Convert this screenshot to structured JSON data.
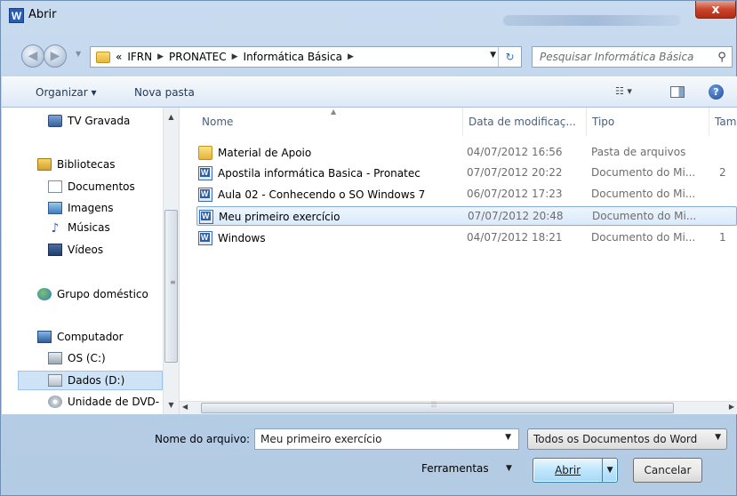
{
  "window": {
    "title": "Abrir",
    "app_icon": "W",
    "close_label": "x"
  },
  "address": {
    "prefix": "«",
    "crumbs": [
      "IFRN",
      "PRONATEC",
      "Informática Básica"
    ],
    "search_placeholder": "Pesquisar Informática Básica"
  },
  "toolbar": {
    "organizar": "Organizar ▾",
    "nova_pasta": "Nova pasta",
    "help": "?"
  },
  "nav": {
    "tv": "TV Gravada",
    "bibliotecas": "Bibliotecas",
    "documentos": "Documentos",
    "imagens": "Imagens",
    "musicas": "Músicas",
    "videos": "Vídeos",
    "grupo": "Grupo doméstico",
    "computador": "Computador",
    "os_c": "OS (C:)",
    "dados_d": "Dados (D:)",
    "dvd": "Unidade de DVD-"
  },
  "columns": {
    "nome": "Nome",
    "data": "Data de modificaç...",
    "tipo": "Tipo",
    "tamanho": "Tam"
  },
  "files": [
    {
      "name": "Material de Apoio",
      "date": "04/07/2012 16:56",
      "type": "Pasta de arquivos",
      "size": ""
    },
    {
      "name": "Apostila informática Basica - Pronatec",
      "date": "07/07/2012 20:22",
      "type": "Documento do Mi...",
      "size": "2"
    },
    {
      "name": "Aula 02 - Conhecendo o SO Windows 7",
      "date": "06/07/2012 17:23",
      "type": "Documento do Mi...",
      "size": ""
    },
    {
      "name": "Meu primeiro exercício",
      "date": "07/07/2012 20:48",
      "type": "Documento do Mi...",
      "size": ""
    },
    {
      "name": "Windows",
      "date": "04/07/2012 18:21",
      "type": "Documento do Mi...",
      "size": "1"
    }
  ],
  "bottom": {
    "filename_label": "Nome do arquivo:",
    "filename_value": "Meu primeiro exercício",
    "filetype_value": "Todos os Documentos do Word",
    "ferramentas": "Ferramentas",
    "abrir": "Abrir",
    "cancelar": "Cancelar"
  }
}
